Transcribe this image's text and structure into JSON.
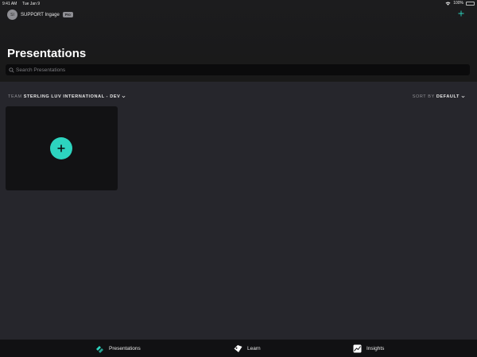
{
  "status_bar": {
    "time": "9:41 AM",
    "date": "Tue Jan 9",
    "battery": "100%"
  },
  "account": {
    "initials": "SI",
    "name": "SUPPORT Ingage",
    "badge": "Pro"
  },
  "header": {
    "title": "Presentations",
    "add_icon": "plus-icon"
  },
  "search": {
    "placeholder": "Search Presentations",
    "value": ""
  },
  "filters": {
    "team_label": "TEAM",
    "team_value": "STERLING LUV INTERNATIONAL - DEV",
    "sort_label": "SORT BY",
    "sort_value": "DEFAULT"
  },
  "content": {
    "new_presentation_icon": "plus-icon"
  },
  "tabs": [
    {
      "label": "Presentations",
      "icon": "presentations-icon"
    },
    {
      "label": "Learn",
      "icon": "learn-icon"
    },
    {
      "label": "Insights",
      "icon": "insights-icon"
    }
  ],
  "colors": {
    "accent": "#2dd4bf",
    "background": "#26262c",
    "header": "#1c1c1e",
    "card": "#121214",
    "battery": "#34c759"
  }
}
